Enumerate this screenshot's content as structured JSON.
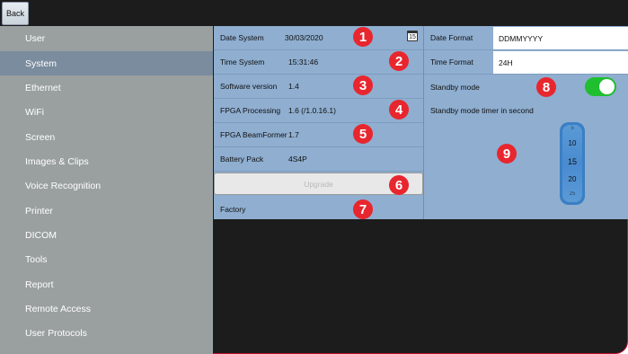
{
  "back": {
    "label": "Back"
  },
  "sidebar": {
    "items": [
      {
        "label": "User"
      },
      {
        "label": "System"
      },
      {
        "label": "Ethernet"
      },
      {
        "label": "WiFi"
      },
      {
        "label": "Screen"
      },
      {
        "label": "Images & Clips"
      },
      {
        "label": "Voice Recognition"
      },
      {
        "label": "Printer"
      },
      {
        "label": "DICOM"
      },
      {
        "label": "Tools"
      },
      {
        "label": "Report"
      },
      {
        "label": "Remote Access"
      },
      {
        "label": "User Protocols"
      }
    ]
  },
  "system": {
    "date_label": "Date System",
    "date_value": "30/03/2020",
    "time_label": "Time System",
    "time_value": "15:31:46",
    "sw_label": "Software version",
    "sw_value": "1.4",
    "fpga_label": "FPGA Processing",
    "fpga_value": "1.6 (/1.0.16.1)",
    "beam_label": "FPGA BeamFormer",
    "beam_value": "1.7",
    "battery_label": "Battery Pack",
    "battery_value": "4S4P",
    "upgrade_label": "Upgrade",
    "factory_label": "Factory",
    "calendar_day": "15"
  },
  "right": {
    "date_format_label": "Date Format",
    "date_format_value": "DDMMYYYY",
    "time_format_label": "Time Format",
    "time_format_value": "24H",
    "standby_label": "Standby mode",
    "standby_on": true,
    "timer_label": "Standby mode timer in second",
    "wheel_values": [
      "5",
      "10",
      "15",
      "20",
      "25"
    ]
  },
  "badges": [
    "1",
    "2",
    "3",
    "4",
    "5",
    "6",
    "7",
    "8",
    "9"
  ],
  "colors": {
    "accent_red": "#e8262e",
    "toggle_on": "#1fbf2f",
    "panel": "#8faed0"
  }
}
